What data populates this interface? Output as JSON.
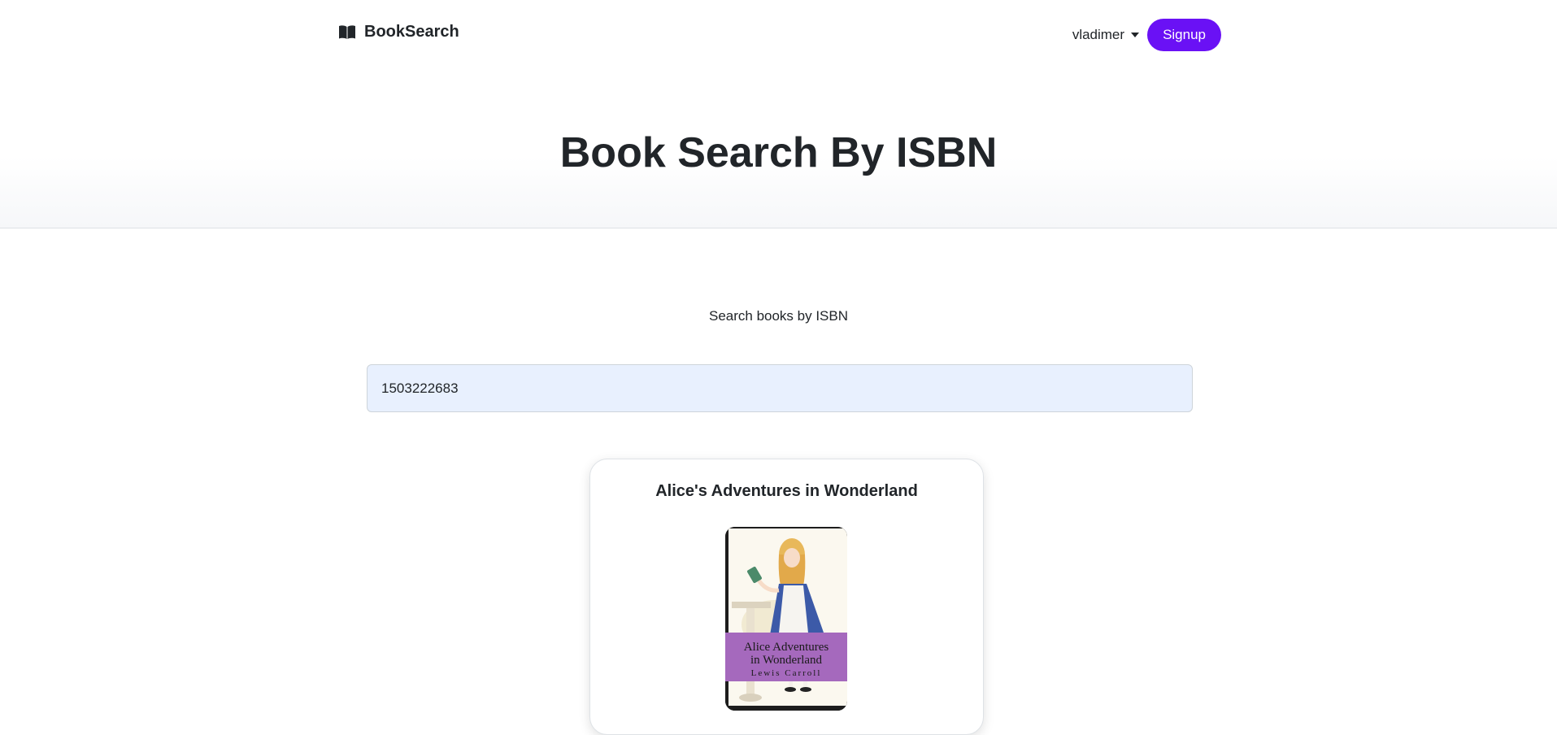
{
  "navbar": {
    "brand_name": "BookSearch",
    "brand_icon": "open-book-icon",
    "username": "vladimer",
    "signup_label": "Signup"
  },
  "hero": {
    "title": "Book Search By ISBN"
  },
  "search": {
    "label": "Search books by ISBN",
    "value": "1503222683"
  },
  "result": {
    "title": "Alice's Adventures in Wonderland",
    "cover": {
      "line1": "Alice Adventures",
      "line2": "in Wonderland",
      "author": "Lewis Carroll"
    }
  },
  "colors": {
    "accent": "#6a11f5",
    "input_bg": "#e8f0fe",
    "cover_band": "#a569bd"
  }
}
